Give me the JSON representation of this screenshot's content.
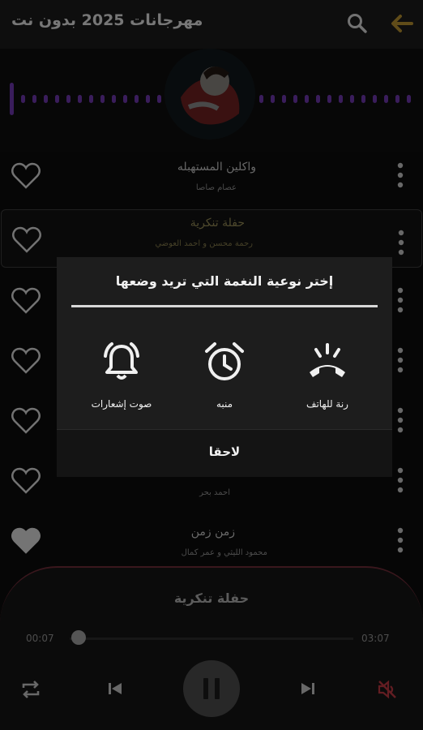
{
  "app": {
    "title": "مهرجانات 2025 بدون نت",
    "accent": "#b08a2e",
    "visualizer_color": "#6a35a8"
  },
  "toolbar": {
    "back_icon": "arrow-back-icon",
    "search_icon": "search-icon"
  },
  "songs": [
    {
      "title": "واكلين المستهبله",
      "artist": "عصام صاصا",
      "liked": false,
      "active": false
    },
    {
      "title": "حفلة تنكرية",
      "artist": "رحمة محسن و احمد العوضي",
      "liked": false,
      "active": true
    },
    {
      "title": "",
      "artist": "",
      "liked": false,
      "active": false
    },
    {
      "title": "",
      "artist": "",
      "liked": false,
      "active": false
    },
    {
      "title": "",
      "artist": "",
      "liked": false,
      "active": false
    },
    {
      "title": "",
      "artist": "احمد بحر",
      "liked": false,
      "active": false
    },
    {
      "title": "زمن زمن",
      "artist": "محمود الليثي و عمر كمال",
      "liked": true,
      "active": false
    }
  ],
  "dialog": {
    "title": "إختر نوعية النغمة التي تريد وضعها",
    "options": [
      {
        "label": "رنة للهاتف",
        "icon": "phone-ringing-icon"
      },
      {
        "label": "منبه",
        "icon": "alarm-clock-icon"
      },
      {
        "label": "صوت إشعارات",
        "icon": "notification-bell-icon"
      }
    ],
    "later_label": "لاحقا"
  },
  "player": {
    "now_playing": "حفلة تنكرية",
    "elapsed": "00:07",
    "duration": "03:07",
    "progress": 0.04,
    "playing": true,
    "muted": true,
    "mute_color": "#b5353f"
  }
}
